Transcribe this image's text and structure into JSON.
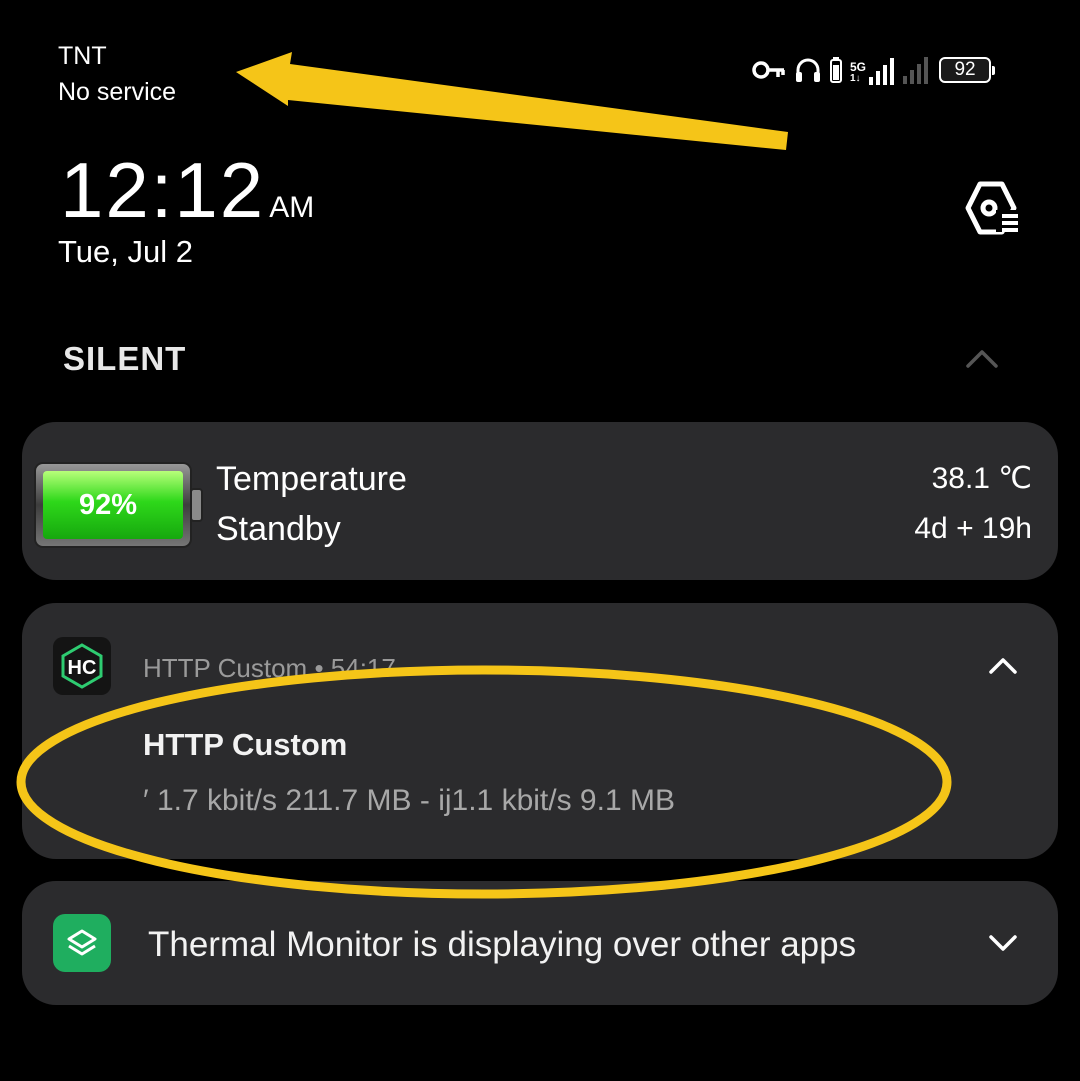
{
  "status_bar": {
    "carrier": "TNT",
    "service": "No service",
    "network_type": "5G",
    "network_sub": "1↓",
    "battery_level": "92",
    "icons": [
      "vpn-key-icon",
      "headphones-icon",
      "battery-small-icon",
      "signal-5g-icon",
      "signal-empty-icon",
      "battery-icon"
    ]
  },
  "clock": {
    "time": "12:12",
    "ampm": "AM",
    "date": "Tue, Jul 2"
  },
  "section": {
    "label": "SILENT"
  },
  "battery_card": {
    "percent": "92%",
    "level_fraction": 0.92,
    "label_1": "Temperature",
    "value_1": "38.1 ℃",
    "label_2": "Standby",
    "value_2": "4d + 19h"
  },
  "http_card": {
    "app_icon_text": "HC",
    "app_name": "HTTP Custom",
    "elapsed": "54:17",
    "title": "HTTP Custom",
    "text": "′ 1.7 kbit/s 211.7 MB - ij1.1 kbit/s 9.1 MB"
  },
  "thermal_card": {
    "text": "Thermal Monitor is displaying over other apps"
  },
  "annotation_color": "#f5c518",
  "card_color": "#2b2b2d"
}
